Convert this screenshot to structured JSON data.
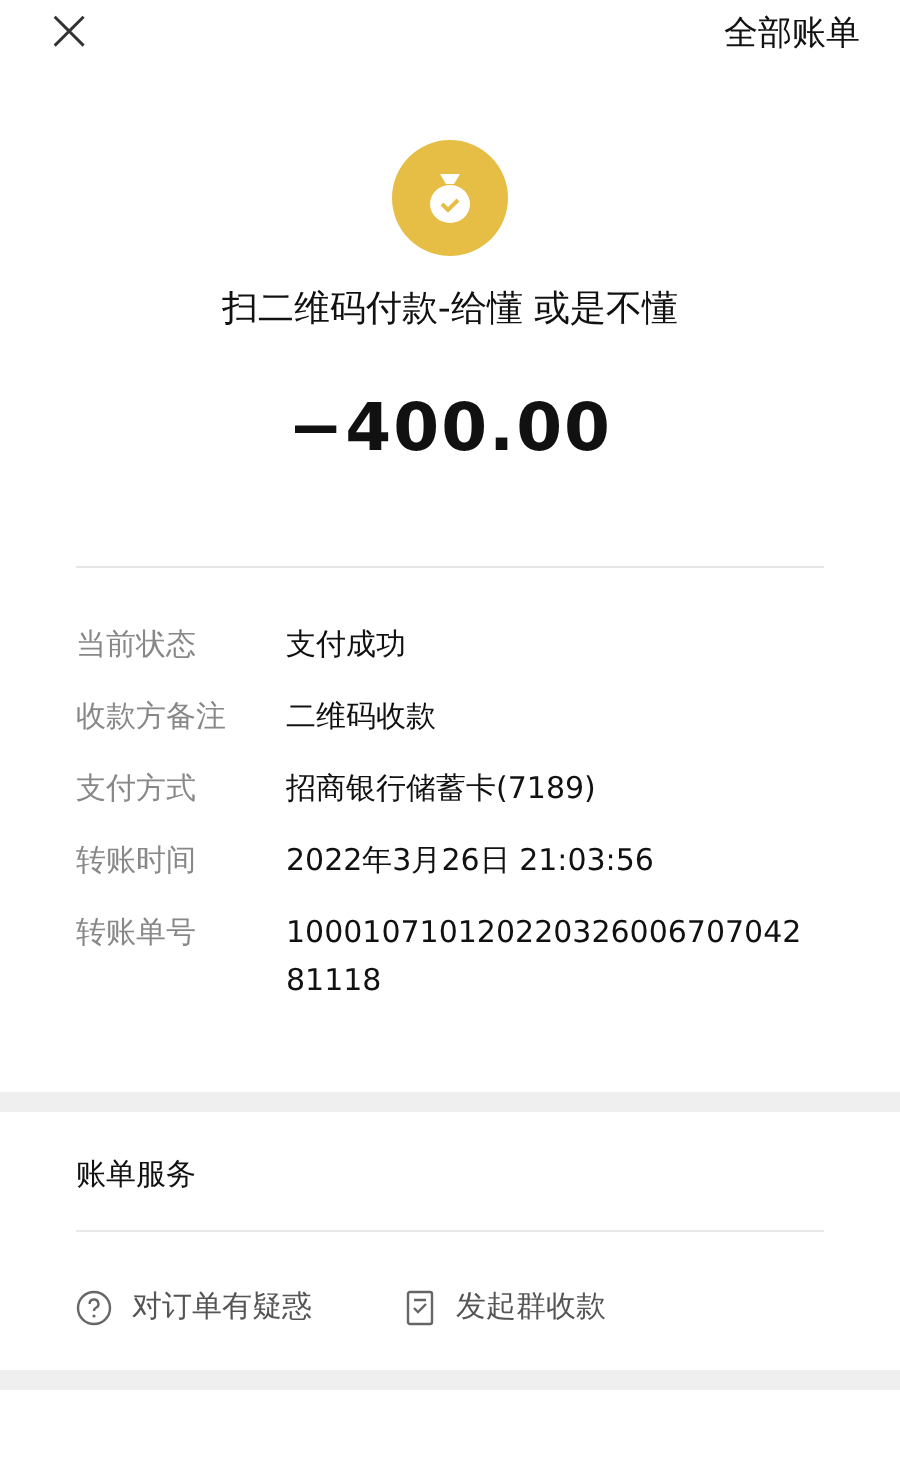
{
  "top_bar": {
    "close": "×",
    "all_bills": "全部账单"
  },
  "payment": {
    "merchant": "扫二维码付款-给懂 或是不懂",
    "amount": "−400.00"
  },
  "details": [
    {
      "label": "当前状态",
      "value": "支付成功"
    },
    {
      "label": "收款方备注",
      "value": "二维码收款"
    },
    {
      "label": "支付方式",
      "value": "招商银行储蓄卡(7189)"
    },
    {
      "label": "转账时间",
      "value": "2022年3月26日 21:03:56"
    },
    {
      "label": "转账单号",
      "value": "100010710120220326006707042 81118"
    }
  ],
  "services": {
    "title": "账单服务",
    "actions": [
      {
        "kind": "question",
        "label": "对订单有疑惑"
      },
      {
        "kind": "group",
        "label": "发起群收款"
      }
    ]
  }
}
